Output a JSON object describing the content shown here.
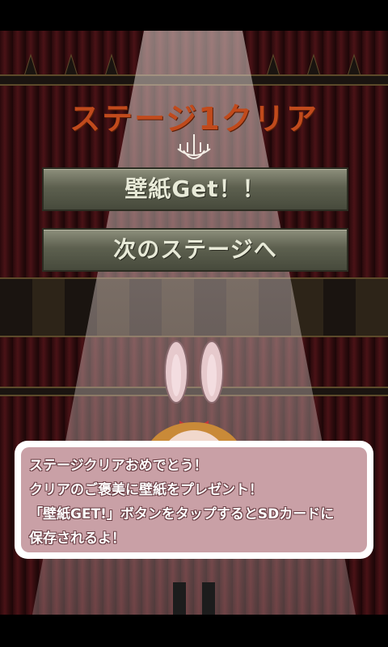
{
  "game": {
    "title": "ステージ1クリア",
    "buttons": {
      "wallpaper_label": "壁紙Get！！",
      "next_stage_label": "次のステージへ"
    },
    "dialog": {
      "lines": [
        "ステージクリアおめでとう！",
        "クリアのご褒美に壁紙をプレゼント！",
        "「壁紙GET!」ボタンをタップするとSDカードに",
        "保存されるよ！"
      ]
    }
  },
  "colors": {
    "title": "#c04a1c",
    "button_face": "#5d604f",
    "dialog_fill": "#c9a0a6",
    "curtain": "#4a1216"
  },
  "icons": {
    "chandelier": "chandelier-icon",
    "character": "bunny-doll-icon"
  }
}
